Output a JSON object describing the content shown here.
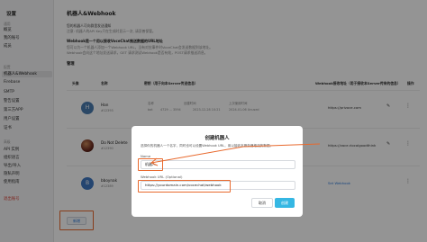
{
  "sidebar": {
    "title": "设置",
    "sections": [
      {
        "label": "通用",
        "items": [
          "概览",
          "我的账号",
          "成员"
        ]
      },
      {
        "label": "配置",
        "items": [
          "机器人&Webhook",
          "Firebase",
          "SMTP",
          "警告设置",
          "第三方APP",
          "用户设置",
          "证书"
        ]
      },
      {
        "label": "高级",
        "items": [
          "API 实例",
          "组织语言",
          "导出/导入",
          "隐私声明",
          "使用指南"
        ]
      }
    ],
    "danger_item": "退出账号"
  },
  "main": {
    "title": "机器人&Webhook",
    "intro_lines": [
      "您的机器人可向群里发送通知",
      "注意: 机器人的API Key只在生成时显示一次, 请妥善保管。"
    ],
    "webhook_heading": "Webhook是一个用以接收VoceChat推送数据的URL地址",
    "webhook_lines": [
      "您可以为一个机器人添加一个Webhook URL，当有对应事件时VoceChat会发送数据到该地址。",
      "Webhook会向这个地址发送请求，GET 请求测试Webhook是否有效，POST请求推送消息。"
    ],
    "section_title": "管理",
    "columns": {
      "avatar": "头像",
      "name": "名称",
      "key": "密钥（用于向本Server传送信息）",
      "webhook": "Webhook接收地址（用于接收本Server传来的信息）",
      "ops": "操作"
    },
    "key_subcols": {
      "name": "名称",
      "created": "创建时间",
      "last_used": "上次使用时间"
    },
    "rows": [
      {
        "initial": "H",
        "name": "Han",
        "id": "#12393",
        "key_name": "bot",
        "key_masked": "4729 ... 3594",
        "created": "2023-12-28 10:21",
        "last_used": "2024-01-06 Unused",
        "webhook": "https://privoce.com",
        "avatar_color": "#4a7cb0"
      },
      {
        "initial": "",
        "name": "Do Not Delete",
        "id": "#12390",
        "key_name": "",
        "key_masked": "",
        "created": "",
        "last_used": "",
        "webhook": "https://voce.rlocalgoodthink",
        "avatar_color": "#6b2a1f"
      },
      {
        "initial": "B",
        "name": "bboynak",
        "id": "#12389",
        "key_name": "",
        "key_masked": "",
        "created": "",
        "last_used": "",
        "webhook": "Set Webhook",
        "avatar_color": "#3e78c2"
      }
    ],
    "edit_icon": "pencil-icon",
    "more_icon": "more-vertical-icon",
    "new_button": "新增"
  },
  "modal": {
    "title": "创建机器人",
    "desc_lines": [
      "选择你的机器人一个名字，同时也可以设置Webhook URL，用以接收本服务器推送的数据。"
    ],
    "name_label": "Name",
    "name_value": "机器人",
    "url_label": "Webhook URL (Optional)",
    "url_value": "https://yourdomain.com/vocechat/webhook",
    "cancel_label": "取消",
    "ok_label": "创建"
  },
  "colors": {
    "accent": "#35b7e3",
    "annotation": "#e8692d",
    "link": "#2f7ad8"
  }
}
